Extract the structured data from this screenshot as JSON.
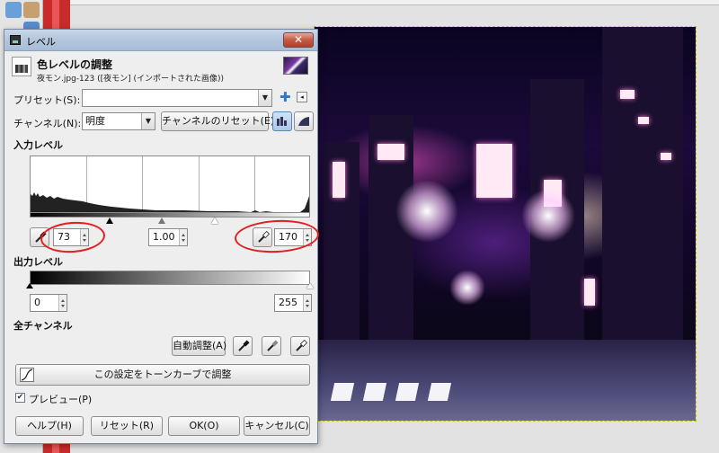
{
  "dialog": {
    "title": "レベル",
    "close_label": "✕",
    "header_title": "色レベルの調整",
    "header_subtitle": "夜モン.jpg-123 ([夜モン] (インポートされた画像))"
  },
  "presets": {
    "label": "プリセット(S):",
    "value": ""
  },
  "channel": {
    "label": "チャンネル(N):",
    "value": "明度",
    "reset_label": "チャンネルのリセット(E)"
  },
  "input_levels": {
    "section_label": "入力レベル",
    "low": "73",
    "gamma": "1.00",
    "high": "170"
  },
  "output_levels": {
    "section_label": "出力レベル",
    "low": "0",
    "high": "255"
  },
  "all_channels": {
    "section_label": "全チャンネル",
    "auto_label": "自動調整(A)"
  },
  "curves_button_label": "この設定をトーンカーブで調整",
  "preview": {
    "label": "プレビュー(P)",
    "checked": true
  },
  "buttons": {
    "help": "ヘルプ(H)",
    "reset": "リセット(R)",
    "ok": "OK(O)",
    "cancel": "キャンセル(C)"
  },
  "icons": [
    "add-preset-icon",
    "preset-menu-icon",
    "linear-histogram-icon",
    "log-histogram-icon",
    "eyedropper-icon",
    "curves-icon",
    "window-icon"
  ],
  "colors": {
    "annotation_circle": "#e02020",
    "title_bar": "#b3c6dd",
    "close_button": "#c65a44"
  }
}
